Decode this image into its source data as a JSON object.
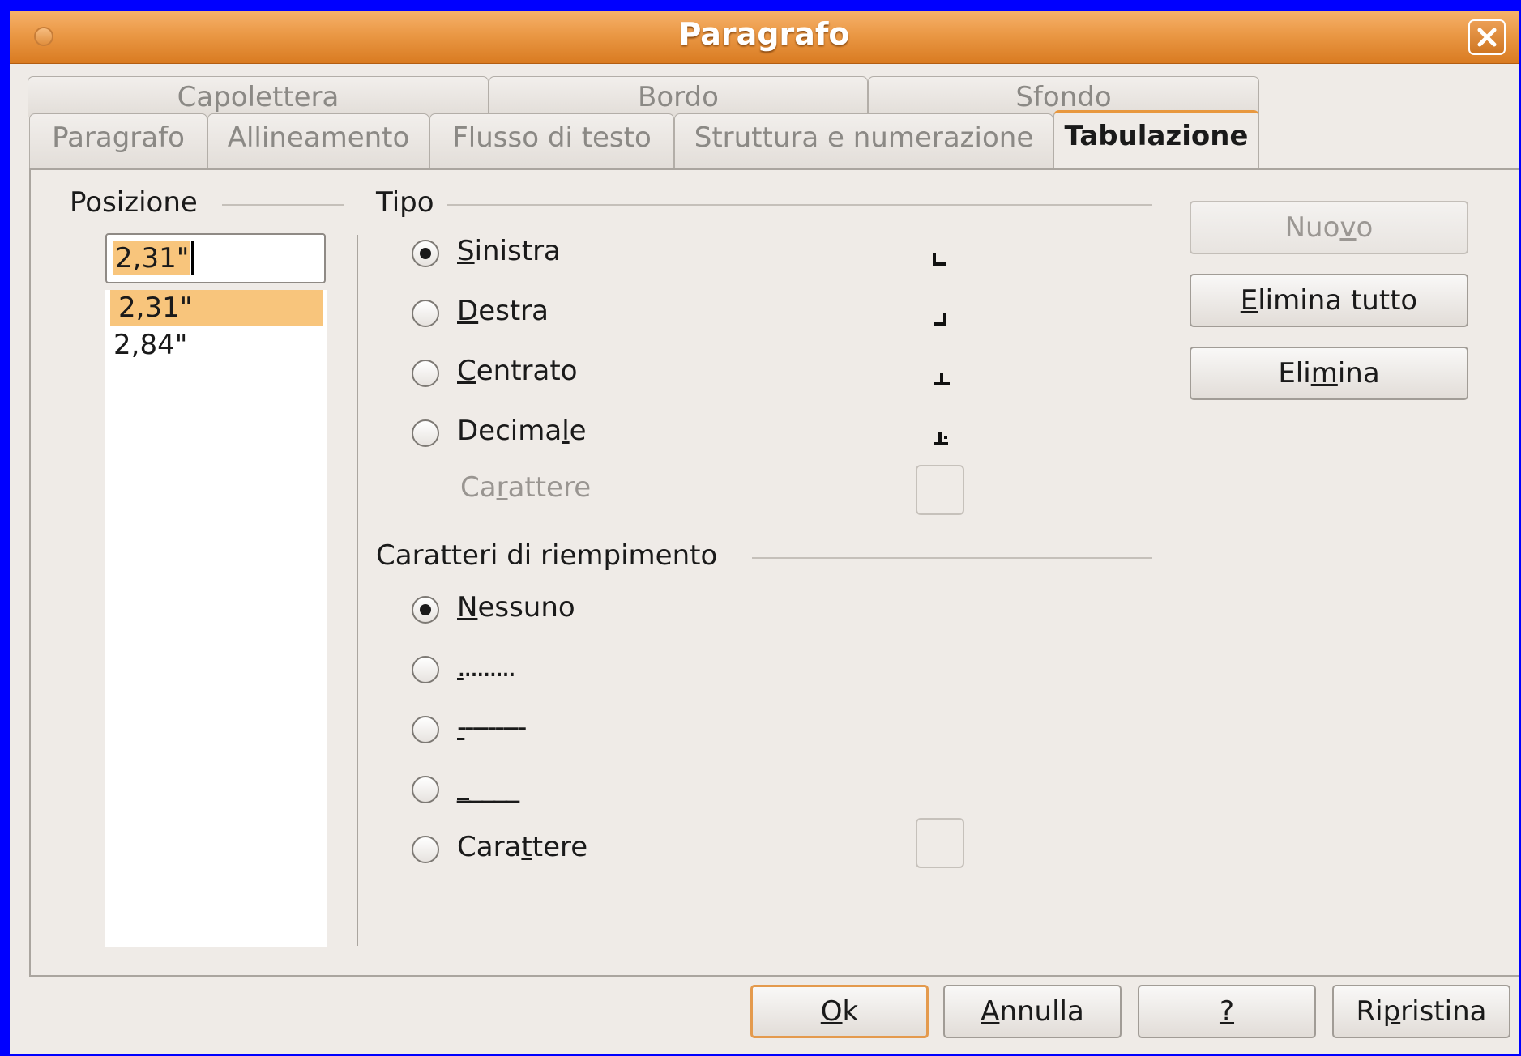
{
  "window": {
    "title": "Paragrafo"
  },
  "tabs_row1": [
    {
      "label": "Capolettera"
    },
    {
      "label": "Bordo"
    },
    {
      "label": "Sfondo"
    }
  ],
  "tabs_row2": [
    {
      "label": "Paragrafo"
    },
    {
      "label": "Allineamento"
    },
    {
      "label": "Flusso di testo"
    },
    {
      "label": "Struttura e numerazione"
    },
    {
      "label": "Tabulazione",
      "active": true
    }
  ],
  "position": {
    "label": "Posizione",
    "input_value": "2,31\"",
    "list": [
      "2,31\"",
      "2,84\""
    ]
  },
  "type": {
    "label": "Tipo",
    "options": [
      {
        "pre": "",
        "u": "S",
        "post": "inistra",
        "checked": true
      },
      {
        "pre": "",
        "u": "D",
        "post": "estra",
        "checked": false
      },
      {
        "pre": "",
        "u": "C",
        "post": "entrato",
        "checked": false
      },
      {
        "pre": "Decima",
        "u": "l",
        "post": "e",
        "checked": false
      }
    ],
    "character": {
      "pre": "Ca",
      "u": "r",
      "post": "attere"
    }
  },
  "fill": {
    "label": "Caratteri di riempimento",
    "options": [
      {
        "pre": "",
        "u": "N",
        "post": "essuno",
        "checked": true
      },
      {
        "pre": "",
        "u": ".",
        "post": "........",
        "checked": false
      },
      {
        "pre": "",
        "u": "-",
        "post": "--------",
        "checked": false
      },
      {
        "pre": "",
        "u": "_",
        "post": "____",
        "checked": false
      },
      {
        "pre": "Cara",
        "u": "t",
        "post": "tere",
        "checked": false
      }
    ]
  },
  "side_buttons": {
    "new": {
      "pre": "Nuo",
      "u": "v",
      "post": "o"
    },
    "delete_all": {
      "pre": "",
      "u": "E",
      "post": "limina tutto"
    },
    "delete": {
      "pre": "Eli",
      "u": "m",
      "post": "ina"
    }
  },
  "footer_buttons": {
    "ok": {
      "pre": "",
      "u": "O",
      "post": "k"
    },
    "cancel": {
      "pre": "",
      "u": "A",
      "post": "nnulla"
    },
    "help": {
      "pre": "",
      "u": "?",
      "post": ""
    },
    "reset": {
      "pre": "Ri",
      "u": "p",
      "post": "ristina"
    }
  },
  "colors": {
    "titlebar": "#e08a33",
    "selection": "#f8c57c",
    "dialog_bg": "#efebe7",
    "desktop": "#0000ff"
  }
}
